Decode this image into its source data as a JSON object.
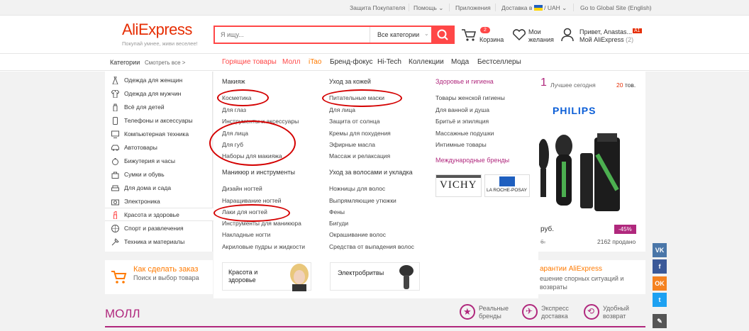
{
  "topbar": {
    "protection": "Защита Покупателя",
    "help": "Помощь",
    "apps": "Приложения",
    "delivery": "Доставка в",
    "currency": "UAH",
    "global": "Go to Global Site (English)"
  },
  "header": {
    "logo": "AliExpress",
    "tagline": "Покупай умнее, живи веселее!",
    "search_placeholder": "Я ищу...",
    "search_category": "Все категории",
    "cart_count": "2",
    "cart_label": "Корзина",
    "wishlist_label": "Мои желания",
    "user_hello": "Привет, Anastas...",
    "user_badge": "A1",
    "user_my": "Мой AliExpress",
    "user_count": "(2)"
  },
  "nav": {
    "categories": "Категории",
    "see_all": "Смотреть все >",
    "items": [
      "Горящие товары",
      "Молл",
      "iTao",
      "Бренд-фокус",
      "Hi-Tech",
      "Коллекции",
      "Мода",
      "Бестселлеры"
    ]
  },
  "categories": [
    {
      "label": "Одежда для женщин",
      "icon": "dress-icon"
    },
    {
      "label": "Одежда для мужчин",
      "icon": "shirt-icon"
    },
    {
      "label": "Всё для детей",
      "icon": "baby-bottle-icon"
    },
    {
      "label": "Телефоны и аксессуары",
      "icon": "phone-icon"
    },
    {
      "label": "Компьютерная техника",
      "icon": "computer-icon"
    },
    {
      "label": "Автотовары",
      "icon": "car-icon"
    },
    {
      "label": "Бижутерия и часы",
      "icon": "ring-icon"
    },
    {
      "label": "Сумки и обувь",
      "icon": "bag-icon"
    },
    {
      "label": "Для дома и сада",
      "icon": "sofa-icon"
    },
    {
      "label": "Электроника",
      "icon": "camera-icon"
    },
    {
      "label": "Красота и здоровье",
      "icon": "lipstick-icon"
    },
    {
      "label": "Спорт и развлечения",
      "icon": "ball-icon"
    },
    {
      "label": "Техника и материалы",
      "icon": "tools-icon"
    }
  ],
  "mega": {
    "col1": {
      "head1": "Макияж",
      "links1": [
        "Косметика",
        "Для глаз",
        "Инструменты и аксессуары",
        "Для лица",
        "Для губ",
        "Наборы для макияжа"
      ],
      "head2": "Маникюр и инструменты",
      "links2": [
        "Дизайн ногтей",
        "Наращивание ногтей",
        "Лаки для ногтей",
        "Инструменты для маникюра",
        "Накладные ногти",
        "Акриловые пудры и жидкости"
      ]
    },
    "col2": {
      "head1": "Уход за кожей",
      "links1": [
        "Питательные маски",
        "Для лица",
        "Защита от солнца",
        "Кремы для похудения",
        "Эфирные масла",
        "Массаж и релаксация"
      ],
      "head2": "Уход за волосами и укладка",
      "links2": [
        "Ножницы для волос",
        "Выпрямляющие утюжки",
        "Фены",
        "Бигуди",
        "Окрашивание волос",
        "Средства от выпадения волос"
      ]
    },
    "col3": {
      "head1": "Здоровье и гигиена",
      "links1": [
        "Товары женской гигиены",
        "Для ванной и душа",
        "Бритьё и эпиляция",
        "Массажные подушки",
        "Интимные товары"
      ],
      "head2": "Международные бренды",
      "brands": [
        "VICHY",
        "LA ROCHE-POSAY"
      ]
    },
    "promo1": "Красота и здоровье",
    "promo2": "Электробритвы"
  },
  "deal": {
    "num": "1",
    "best": "Лучшее сегодня",
    "count_num": "20",
    "count_unit": "тов.",
    "brand": "PHILIPS",
    "price": "руб.",
    "discount": "-45%",
    "old_price": "6.",
    "sold": "2162 продано"
  },
  "bottom": {
    "howto": "Как сделать заказ",
    "howto_sub": "Поиск и выбор товара",
    "guarantee": "арантии AliExpress",
    "guarantee_sub": "ешение спорных ситуаций и возвраты",
    "mall": "МОЛЛ",
    "features": [
      "Реальные бренды",
      "Экспресс доставка",
      "Удобный возврат"
    ]
  },
  "social": [
    "VK",
    "f",
    "OK",
    "t",
    "✎"
  ],
  "colors": {
    "accent": "#ff4747",
    "brand_purple": "#b0287d",
    "orange": "#ff7a00"
  }
}
